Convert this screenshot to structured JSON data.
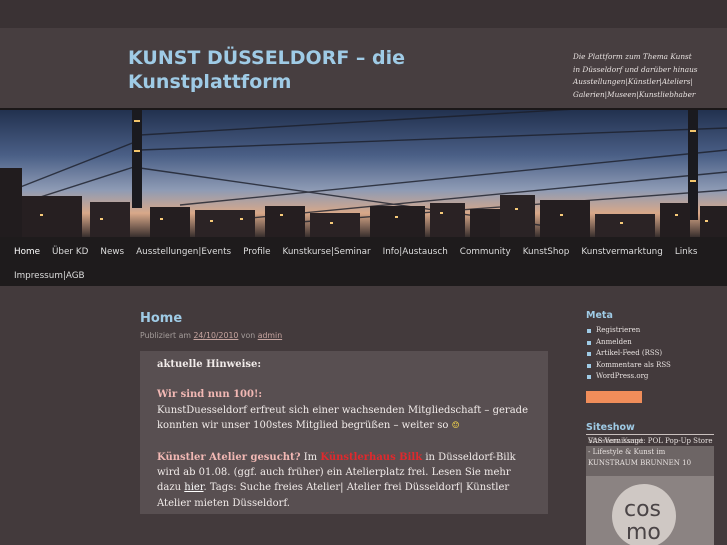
{
  "header": {
    "site_title": "KUNST DÜSSELDORF – die Kunstplattform",
    "tagline": "Die Plattform zum Thema Kunst in Düsseldorf und darüber hinaus Ausstellungen|Künstler|Ateliers| Galerien|Museen|Kunstliebhaber"
  },
  "nav": {
    "row1": [
      "Home",
      "Über KD",
      "News",
      "Ausstellungen|Events",
      "Profile",
      "Kunstkurse|Seminar",
      "Info|Austausch",
      "Community",
      "KunstShop",
      "Kunstvermarktung",
      "Links"
    ],
    "row2": [
      "Impressum|AGB"
    ]
  },
  "post": {
    "title": "Home",
    "meta_prefix": "Publiziert am",
    "date": "24/10/2010",
    "meta_by": "von",
    "author": "admin",
    "heading": "aktuelle Hinweise:",
    "item1_title": "Wir sind nun 100!:",
    "item1_text": "KunstDuesseldorf erfreut sich einer wachsenden Mitgliedschaft – gerade konnten wir unser 100stes Mitglied begrüßen – weiter so",
    "smiley": "☺",
    "item2_title": "Künstler Atelier gesucht?",
    "item2_pre": "Im",
    "item2_highlight": "Künstlerhaus Bilk",
    "item2_text1": "in Düsseldorf-Bilk wird ab 01.08. (ggf. auch früher) ein Atelierplatz frei. Lesen Sie mehr dazu",
    "item2_link": "hier",
    "item2_text2": ". Tags: Suche freies Atelier| Atelier frei Düsseldorf| Künstler Atelier mieten Düsseldorf."
  },
  "sidebar": {
    "meta_title": "Meta",
    "meta_items": [
      "Registrieren",
      "Anmelden",
      "Artikel-Feed (RSS)",
      "Kommentare als RSS",
      "WordPress.org"
    ],
    "siteshow_title": "Siteshow",
    "siteshow_text_a": "VAS-Vernissage: POL Pop-Up Store - Lifestyle & Kunst im KUNSTRAUM BRUNNEN 10",
    "siteshow_text_b": "Siteshow Kunst",
    "siteshow_image_text": "cos mo"
  }
}
